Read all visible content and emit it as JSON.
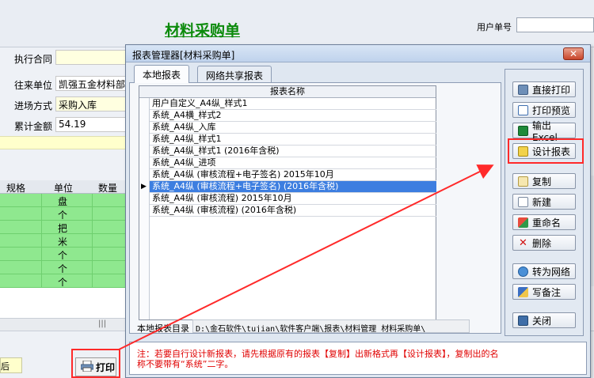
{
  "form": {
    "title": "材料采购单",
    "user_no_label": "用户单号",
    "fields": [
      {
        "label": "执行合同",
        "value": ""
      },
      {
        "label": "往来单位",
        "value": "凯强五金材料部"
      },
      {
        "label": "进场方式",
        "value": "采购入库"
      },
      {
        "label": "累计金额",
        "value": "54.19"
      }
    ],
    "grid_headers": [
      "规格",
      "单位",
      "数量"
    ],
    "grid_units": [
      "盘",
      "个",
      "把",
      "米",
      "个",
      "个",
      "个"
    ],
    "scroll_grip": "|||",
    "small_box_text": "后",
    "print_label": "打印"
  },
  "dialog": {
    "title": "报表管理器[材料采购单]",
    "close_glyph": "✕",
    "tabs": [
      "本地报表",
      "网络共享报表"
    ],
    "list_header": "报表名称",
    "reports": [
      "用户自定义_A4纵_样式1",
      "系统_A4横_样式2",
      "系统_A4纵_入库",
      "系统_A4纵_样式1",
      "系统_A4纵_样式1 (2016年含税)",
      "系统_A4纵_进项",
      "系统_A4纵 (审核流程+电子签名) 2015年10月",
      "系统_A4纵 (审核流程+电子签名) (2016年含税)",
      "系统_A4纵 (审核流程) 2015年10月",
      "系统_A4纵 (审核流程) (2016年含税)"
    ],
    "selected_index": 7,
    "row_marker": "▶",
    "path_label": "本地报表目录",
    "path_value": "D:\\金石软件\\tujian\\软件客户端\\报表\\材料管理_材料采购单\\",
    "buttons": {
      "print": "直接打印",
      "preview": "打印预览",
      "excel": "输出Excel",
      "design": "设计报表",
      "copy": "复制",
      "new": "新建",
      "rename": "重命名",
      "delete": "删除",
      "to_network": "转为网络",
      "remark": "写备注",
      "close": "关闭"
    },
    "note": "注：若要自行设计新报表，请先根据原有的报表【复制】出新格式再【设计报表】，复制出的名称不要带有“系统”二字。"
  },
  "colors": {
    "title_green": "#0b8a0b",
    "row_green": "#8fe88f",
    "selection_blue": "#3d7ee0",
    "highlight_red": "#ff2a2a",
    "note_red": "#e00000"
  }
}
